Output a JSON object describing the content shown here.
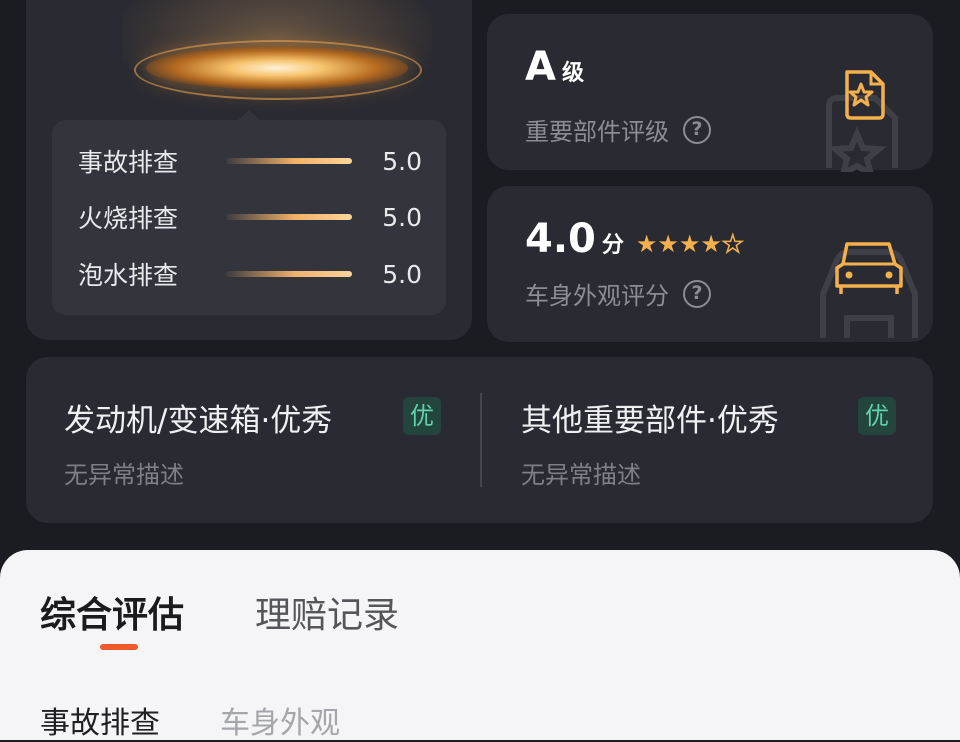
{
  "inspection": {
    "checks": [
      {
        "label": "事故排查",
        "value": "5.0"
      },
      {
        "label": "火烧排查",
        "value": "5.0"
      },
      {
        "label": "泡水排查",
        "value": "5.0"
      }
    ],
    "grade": {
      "value": "A",
      "unit": "级",
      "label": "重要部件评级",
      "help_icon": "?"
    },
    "exterior": {
      "value": "4.0",
      "unit": "分",
      "label": "车身外观评分",
      "help_icon": "?",
      "stars": {
        "filled": 4,
        "total": 5,
        "glyph": "★"
      }
    },
    "parts": [
      {
        "title": "发动机/变速箱·优秀",
        "badge": "优",
        "desc": "无异常描述"
      },
      {
        "title": "其他重要部件·优秀",
        "badge": "优",
        "desc": "无异常描述"
      }
    ]
  },
  "sheet": {
    "tabs": [
      {
        "label": "综合评估",
        "active": true
      },
      {
        "label": "理赔记录",
        "active": false
      }
    ],
    "subtabs": [
      {
        "label": "事故排查",
        "active": true
      },
      {
        "label": "车身外观",
        "active": false
      }
    ]
  },
  "colors": {
    "background": "#1b1c22",
    "card": "#2a2b32",
    "accent_orange": "#f4b04d",
    "badge_green": "#5fd3b0",
    "tab_underline": "#ef5a2b"
  },
  "icons": {
    "grade": "document-star-icon",
    "exterior": "car-front-icon",
    "help": "help-circle-icon"
  }
}
